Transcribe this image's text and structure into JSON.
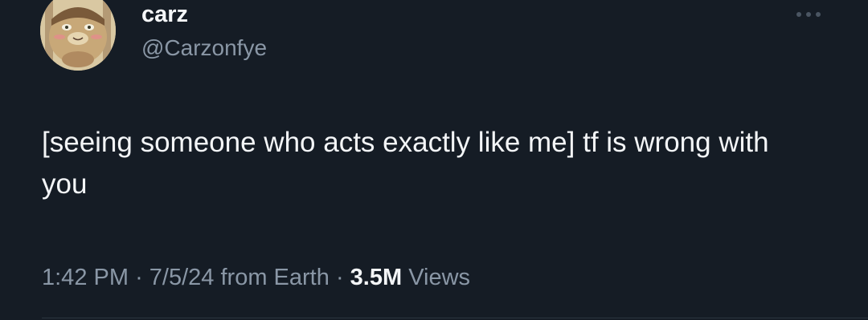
{
  "author": {
    "display_name": "carz",
    "handle": "@Carzonfye",
    "avatar_icon": "cartoon-avatar-icon"
  },
  "menu": {
    "more_icon": "more-options-icon"
  },
  "tweet": {
    "text": "[seeing someone who acts exactly like me] tf is wrong with you",
    "time": "1:42 PM",
    "separator": "·",
    "date": "7/5/24",
    "source": "from Earth",
    "views_count": "3.5M",
    "views_label": "Views"
  },
  "colors": {
    "background": "#151c25",
    "text_primary": "#f3f5f7",
    "text_secondary": "#8a97a6"
  }
}
